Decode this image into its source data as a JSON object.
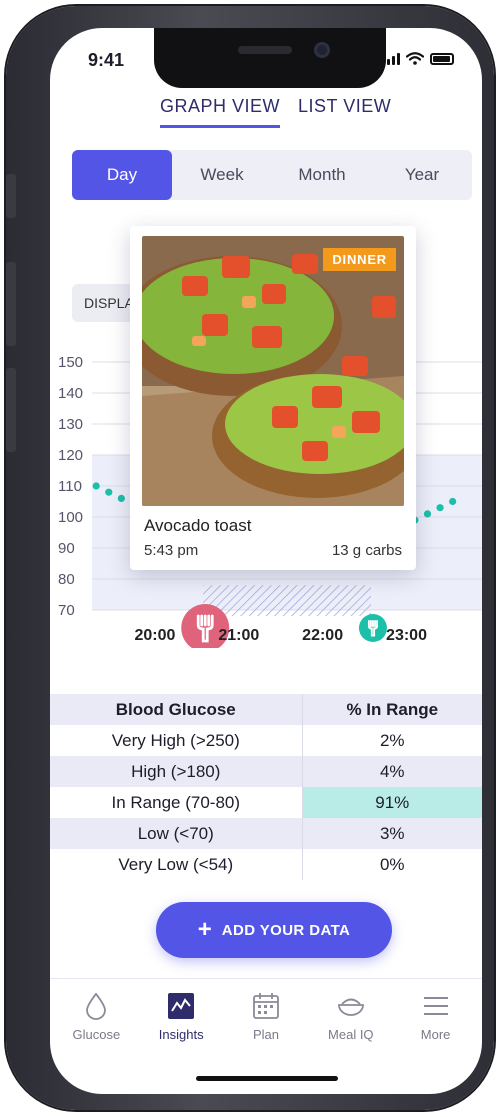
{
  "status": {
    "time": "9:41"
  },
  "view_tabs": [
    {
      "label": "GRAPH VIEW",
      "active": true
    },
    {
      "label": "LIST VIEW",
      "active": false
    }
  ],
  "periods": [
    {
      "label": "Day",
      "active": true
    },
    {
      "label": "Week",
      "active": false
    },
    {
      "label": "Month",
      "active": false
    },
    {
      "label": "Year",
      "active": false
    }
  ],
  "display_button": {
    "label": "DISPLAY"
  },
  "colors": {
    "accent": "#5355e6",
    "teal": "#1cbfa8",
    "meal_pink": "#e0637c",
    "badge": "#f39a1c"
  },
  "chart_data": {
    "type": "scatter",
    "y_ticks": [
      "150",
      "140",
      "130",
      "120",
      "110",
      "100",
      "90",
      "80",
      "70"
    ],
    "ylim": [
      70,
      150
    ],
    "x_ticks": [
      "20:00",
      "21:00",
      "22:00",
      "23:00"
    ],
    "series": [
      {
        "x": [
          19.3,
          19.45,
          19.6,
          19.75,
          19.9,
          22.8,
          22.95,
          23.1,
          23.25,
          23.4,
          23.55
        ],
        "y": [
          110,
          108,
          106,
          104,
          101,
          99,
          98,
          99,
          101,
          103,
          105
        ]
      }
    ],
    "target_range": [
      70,
      120
    ],
    "meal_markers": [
      {
        "time": 20.6,
        "size": "large",
        "color": "#e0637c",
        "icon": "fork-icon"
      },
      {
        "time": 22.6,
        "size": "small",
        "color": "#1cbfa8",
        "icon": "fork-icon"
      }
    ]
  },
  "meal_card": {
    "badge": "DINNER",
    "name": "Avocado toast",
    "time": "5:43 pm",
    "carbs": "13 g carbs"
  },
  "range_table": {
    "headers": [
      "Blood Glucose",
      "% In Range"
    ],
    "rows": [
      {
        "label": "Very High (>250)",
        "value": "2%"
      },
      {
        "label": "High (>180)",
        "value": "4%"
      },
      {
        "label": "In Range (70-80)",
        "value": "91%"
      },
      {
        "label": "Low (<70)",
        "value": "3%"
      },
      {
        "label": "Very Low (<54)",
        "value": "0%"
      }
    ]
  },
  "add_button": {
    "icon": "plus-icon",
    "label": "ADD YOUR DATA"
  },
  "nav": [
    {
      "label": "Glucose",
      "icon": "drop-icon"
    },
    {
      "label": "Insights",
      "icon": "chart-icon",
      "active": true
    },
    {
      "label": "Plan",
      "icon": "calendar-icon"
    },
    {
      "label": "Meal IQ",
      "icon": "bowl-icon"
    },
    {
      "label": "More",
      "icon": "menu-icon"
    }
  ]
}
